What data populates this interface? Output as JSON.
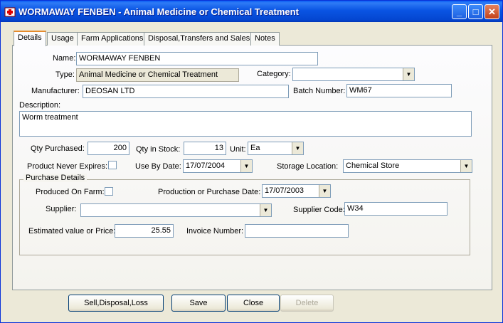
{
  "window": {
    "title": "WORMAWAY FENBEN - Animal Medicine or Chemical Treatment",
    "app_icon": "medicine-chest-icon",
    "minimize_glyph": "_",
    "maximize_glyph": "□",
    "close_glyph": "✕"
  },
  "tabs": [
    {
      "label": "Details",
      "active": true
    },
    {
      "label": "Usage"
    },
    {
      "label": "Farm Applications"
    },
    {
      "label": "Disposal,Transfers and Sales"
    },
    {
      "label": "Notes"
    }
  ],
  "form": {
    "name_label": "Name:",
    "name_value": "WORMAWAY FENBEN",
    "type_label": "Type:",
    "type_value": "Animal Medicine or Chemical Treatment",
    "category_label": "Category:",
    "category_value": "",
    "manufacturer_label": "Manufacturer:",
    "manufacturer_value": "DEOSAN LTD",
    "batch_label": "Batch Number:",
    "batch_value": "WM67",
    "description_label": "Description:",
    "description_value": "Worm treatment",
    "qty_purchased_label": "Qty Purchased:",
    "qty_purchased_value": "200",
    "qty_stock_label": "Qty in Stock:",
    "qty_stock_value": "13",
    "unit_label": "Unit:",
    "unit_value": "Ea",
    "never_expires_label": "Product Never Expires:",
    "never_expires_checked": false,
    "use_by_label": "Use By Date:",
    "use_by_value": "17/07/2004",
    "storage_label": "Storage Location:",
    "storage_value": "Chemical Store"
  },
  "purchase": {
    "group_label": "Purchase Details",
    "produced_label": "Produced On Farm:",
    "produced_checked": false,
    "prod_date_label": "Production or Purchase Date:",
    "prod_date_value": "17/07/2003",
    "supplier_label": "Supplier:",
    "supplier_value": "",
    "supplier_code_label": "Supplier Code:",
    "supplier_code_value": "W34",
    "price_label": "Estimated value or Price:",
    "price_value": "25.55",
    "invoice_label": "Invoice Number:",
    "invoice_value": ""
  },
  "buttons": {
    "sell": "Sell,Disposal,Loss",
    "save": "Save",
    "close": "Close",
    "delete": "Delete"
  },
  "dropdown_glyph": "▼"
}
